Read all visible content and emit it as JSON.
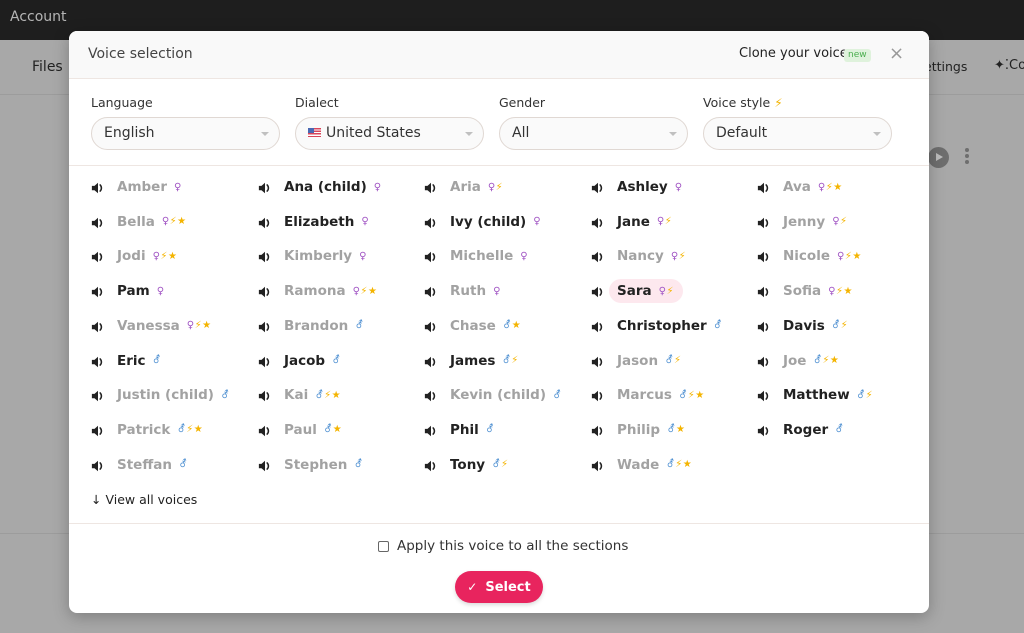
{
  "app": {
    "topbar_title": "Account",
    "tab_files": "Files",
    "tab_settings": "ettings",
    "tab_co": "Co",
    "co_icon": "sparkle-icon"
  },
  "modal": {
    "title": "Voice selection",
    "clone_label": "Clone your voice",
    "new_badge": "new",
    "close_icon": "×"
  },
  "filters": {
    "language": {
      "label": "Language",
      "value": "English"
    },
    "dialect": {
      "label": "Dialect",
      "value": "United States",
      "flag": "us-flag"
    },
    "gender": {
      "label": "Gender",
      "value": "All"
    },
    "voice_style": {
      "label": "Voice style",
      "label_icon": "⚡",
      "value": "Default"
    }
  },
  "legend": {
    "female": "♀",
    "male": "⚦",
    "bolt": "⚡",
    "star": "⭐"
  },
  "voices": [
    {
      "name": "Amber",
      "active": false,
      "gender": "f",
      "bolt": false,
      "star": false
    },
    {
      "name": "Ana (child)",
      "active": true,
      "gender": "f",
      "bolt": false,
      "star": false
    },
    {
      "name": "Aria",
      "active": false,
      "gender": "f",
      "bolt": true,
      "star": false
    },
    {
      "name": "Ashley",
      "active": true,
      "gender": "f",
      "bolt": false,
      "star": false
    },
    {
      "name": "Ava",
      "active": false,
      "gender": "f",
      "bolt": true,
      "star": true
    },
    {
      "name": "Bella",
      "active": false,
      "gender": "f",
      "bolt": true,
      "star": true
    },
    {
      "name": "Elizabeth",
      "active": true,
      "gender": "f",
      "bolt": false,
      "star": false
    },
    {
      "name": "Ivy (child)",
      "active": true,
      "gender": "f",
      "bolt": false,
      "star": false
    },
    {
      "name": "Jane",
      "active": true,
      "gender": "f",
      "bolt": true,
      "star": false
    },
    {
      "name": "Jenny",
      "active": false,
      "gender": "f",
      "bolt": true,
      "star": false
    },
    {
      "name": "Jodi",
      "active": false,
      "gender": "f",
      "bolt": true,
      "star": true
    },
    {
      "name": "Kimberly",
      "active": false,
      "gender": "f",
      "bolt": false,
      "star": false
    },
    {
      "name": "Michelle",
      "active": false,
      "gender": "f",
      "bolt": false,
      "star": false
    },
    {
      "name": "Nancy",
      "active": false,
      "gender": "f",
      "bolt": true,
      "star": false
    },
    {
      "name": "Nicole",
      "active": false,
      "gender": "f",
      "bolt": true,
      "star": true
    },
    {
      "name": "Pam",
      "active": true,
      "gender": "f",
      "bolt": false,
      "star": false
    },
    {
      "name": "Ramona",
      "active": false,
      "gender": "f",
      "bolt": true,
      "star": true
    },
    {
      "name": "Ruth",
      "active": false,
      "gender": "f",
      "bolt": false,
      "star": false
    },
    {
      "name": "Sara",
      "active": true,
      "gender": "f",
      "bolt": true,
      "star": false,
      "selected": true
    },
    {
      "name": "Sofia",
      "active": false,
      "gender": "f",
      "bolt": true,
      "star": true
    },
    {
      "name": "Vanessa",
      "active": false,
      "gender": "f",
      "bolt": true,
      "star": true
    },
    {
      "name": "Brandon",
      "active": false,
      "gender": "m",
      "bolt": false,
      "star": false
    },
    {
      "name": "Chase",
      "active": false,
      "gender": "m",
      "bolt": false,
      "star": true
    },
    {
      "name": "Christopher",
      "active": true,
      "gender": "m",
      "bolt": false,
      "star": false
    },
    {
      "name": "Davis",
      "active": true,
      "gender": "m",
      "bolt": true,
      "star": false
    },
    {
      "name": "Eric",
      "active": true,
      "gender": "m",
      "bolt": false,
      "star": false
    },
    {
      "name": "Jacob",
      "active": true,
      "gender": "m",
      "bolt": false,
      "star": false
    },
    {
      "name": "James",
      "active": true,
      "gender": "m",
      "bolt": true,
      "star": false
    },
    {
      "name": "Jason",
      "active": false,
      "gender": "m",
      "bolt": true,
      "star": false
    },
    {
      "name": "Joe",
      "active": false,
      "gender": "m",
      "bolt": true,
      "star": true
    },
    {
      "name": "Justin (child)",
      "active": false,
      "gender": "m",
      "bolt": false,
      "star": false
    },
    {
      "name": "Kai",
      "active": false,
      "gender": "m",
      "bolt": true,
      "star": true
    },
    {
      "name": "Kevin (child)",
      "active": false,
      "gender": "m",
      "bolt": false,
      "star": false
    },
    {
      "name": "Marcus",
      "active": false,
      "gender": "m",
      "bolt": true,
      "star": true
    },
    {
      "name": "Matthew",
      "active": true,
      "gender": "m",
      "bolt": true,
      "star": false
    },
    {
      "name": "Patrick",
      "active": false,
      "gender": "m",
      "bolt": true,
      "star": true
    },
    {
      "name": "Paul",
      "active": false,
      "gender": "m",
      "bolt": false,
      "star": true
    },
    {
      "name": "Phil",
      "active": true,
      "gender": "m",
      "bolt": false,
      "star": false
    },
    {
      "name": "Philip",
      "active": false,
      "gender": "m",
      "bolt": false,
      "star": true
    },
    {
      "name": "Roger",
      "active": true,
      "gender": "m",
      "bolt": false,
      "star": false
    },
    {
      "name": "Steffan",
      "active": false,
      "gender": "m",
      "bolt": false,
      "star": false
    },
    {
      "name": "Stephen",
      "active": false,
      "gender": "m",
      "bolt": false,
      "star": false
    },
    {
      "name": "Tony",
      "active": true,
      "gender": "m",
      "bolt": true,
      "star": false
    },
    {
      "name": "Wade",
      "active": false,
      "gender": "m",
      "bolt": true,
      "star": true
    }
  ],
  "view_all": {
    "icon": "↓",
    "label": "View all voices"
  },
  "footer": {
    "apply_label": "Apply this voice to all the sections",
    "apply_checked": false,
    "select_icon": "✓",
    "select_label": "Select"
  },
  "colors": {
    "accent": "#e8245e",
    "selected_bg": "#fde8ee",
    "female": "#a155c4",
    "male": "#4d8fd1",
    "bolt": "#f4b400"
  }
}
